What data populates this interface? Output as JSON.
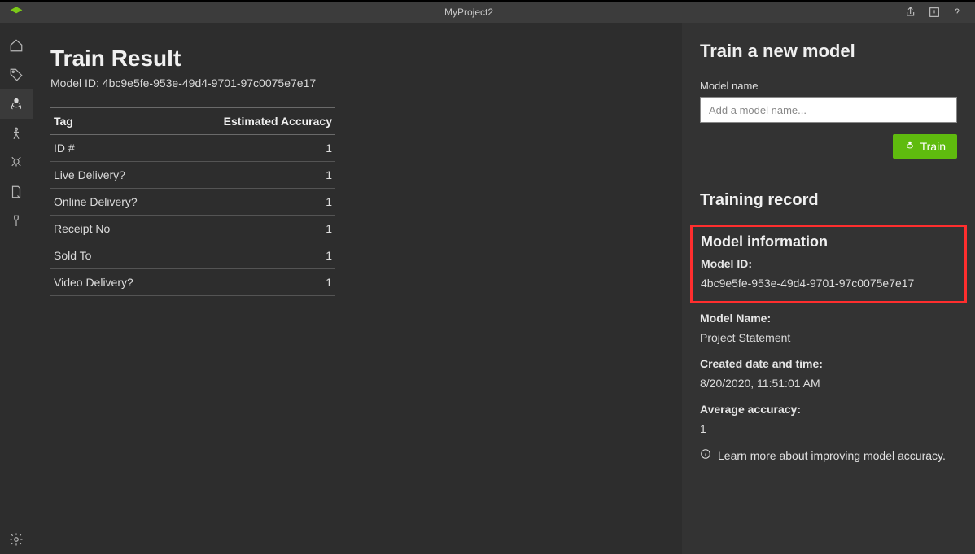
{
  "app": {
    "title": "MyProject2"
  },
  "main": {
    "heading": "Train Result",
    "model_id_label": "Model ID: 4bc9e5fe-953e-49d4-9701-97c0075e7e17",
    "table": {
      "col_tag": "Tag",
      "col_acc": "Estimated Accuracy",
      "rows": [
        {
          "tag": "ID #",
          "acc": "1"
        },
        {
          "tag": "Live Delivery?",
          "acc": "1"
        },
        {
          "tag": "Online Delivery?",
          "acc": "1"
        },
        {
          "tag": "Receipt No",
          "acc": "1"
        },
        {
          "tag": "Sold To",
          "acc": "1"
        },
        {
          "tag": "Video Delivery?",
          "acc": "1"
        }
      ]
    }
  },
  "side": {
    "train_heading": "Train a new model",
    "model_name_label": "Model name",
    "model_name_placeholder": "Add a model name...",
    "train_button": "Train",
    "record_heading": "Training record",
    "info_heading": "Model information",
    "model_id_label": "Model ID:",
    "model_id_value": "4bc9e5fe-953e-49d4-9701-97c0075e7e17",
    "model_name_k": "Model Name:",
    "model_name_v": "Project Statement",
    "created_k": "Created date and time:",
    "created_v": "8/20/2020, 11:51:01 AM",
    "avgacc_k": "Average accuracy:",
    "avgacc_v": "1",
    "learn_more": "Learn more about improving model accuracy."
  },
  "colors": {
    "accent": "#5fbb0e",
    "highlight": "#ff2e2e"
  }
}
